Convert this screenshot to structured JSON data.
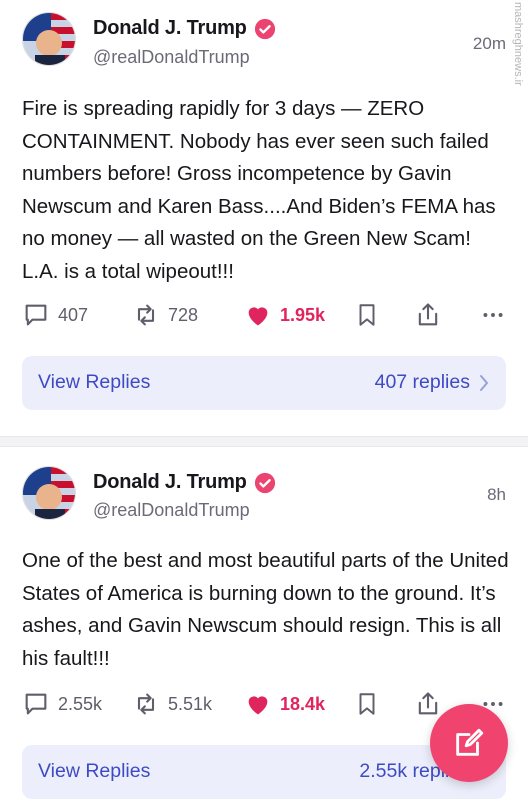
{
  "watermark": "mashreghnews.ir",
  "posts": [
    {
      "name": "Donald J. Trump",
      "handle": "@realDonaldTrump",
      "time": "20m",
      "text": "Fire is spreading rapidly for 3 days — ZERO CONTAINMENT. Nobody has ever seen such failed numbers before! Gross incompetence by Gavin Newscum and Karen Bass....And Biden’s FEMA has no money — all wasted on the Green New Scam! L.A. is a total wipeout!!!",
      "replies": "407",
      "reposts": "728",
      "likes": "1.95k",
      "view_replies_label": "View Replies",
      "replies_count_label": "407 replies"
    },
    {
      "name": "Donald J. Trump",
      "handle": "@realDonaldTrump",
      "time": "8h",
      "text": "One of the best and most beautiful parts of the United States of America is burning down to the ground. It’s ashes, and Gavin Newscum should resign. This is all his fault!!!",
      "replies": "2.55k",
      "reposts": "5.51k",
      "likes": "18.4k",
      "view_replies_label": "View Replies",
      "replies_count_label": "2.55k replies"
    }
  ],
  "icons": {
    "reply": "speech-bubble-icon",
    "repost": "repost-arrows-icon",
    "like": "heart-icon",
    "bookmark": "bookmark-icon",
    "share": "share-icon",
    "more": "more-dots-icon",
    "compose": "compose-pencil-icon"
  },
  "colors": {
    "like": "#e0245e",
    "verified": "#ec4471",
    "replies_bar_bg": "#eceefb",
    "replies_text": "#3e4ac4",
    "fab": "#f0436e"
  }
}
